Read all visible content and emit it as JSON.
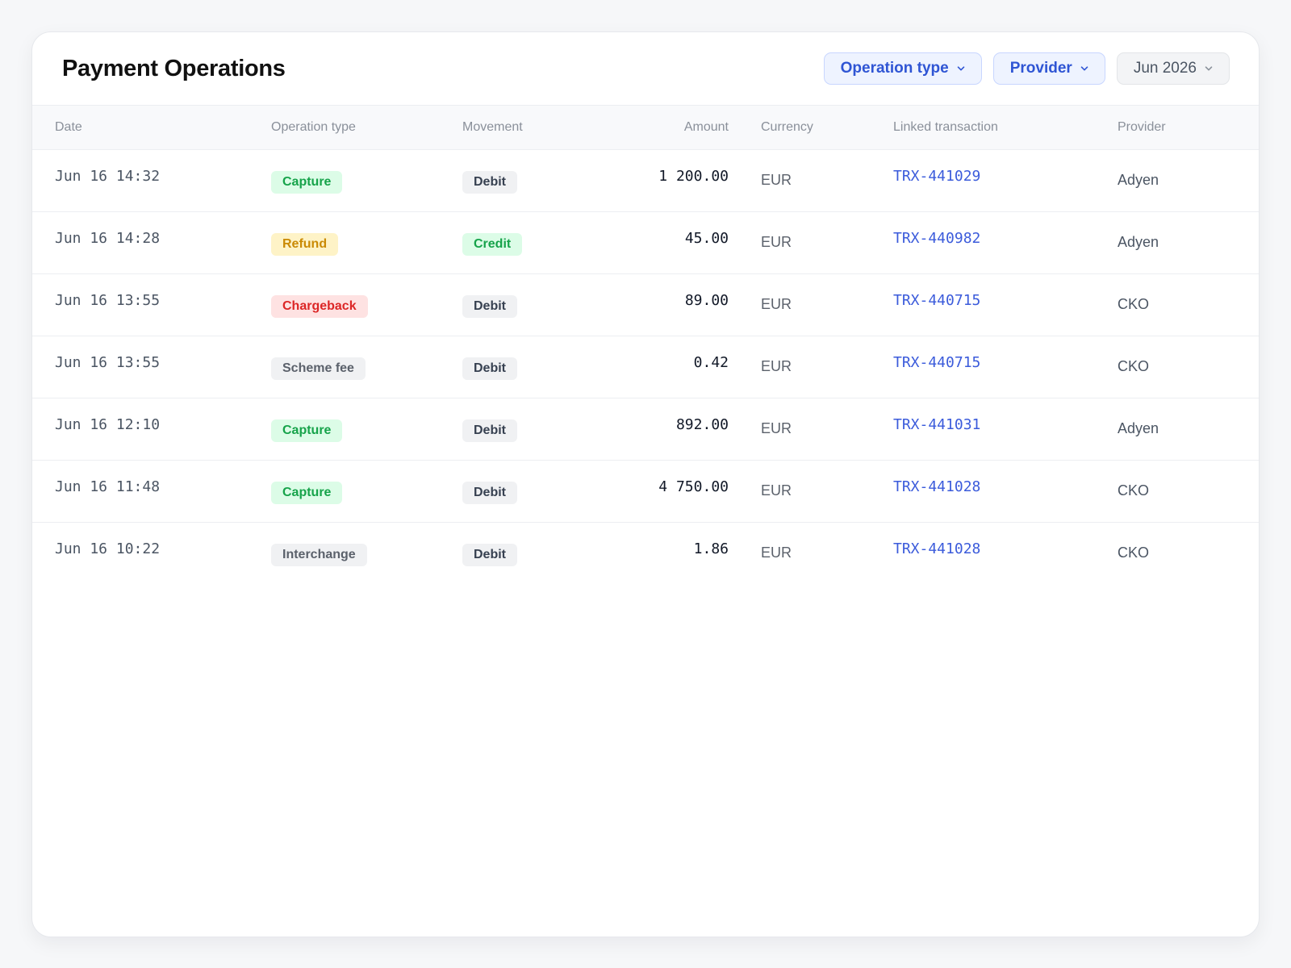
{
  "header": {
    "title": "Payment Operations",
    "filters": [
      {
        "label": "Operation type",
        "state": "active"
      },
      {
        "label": "Provider",
        "state": "active"
      },
      {
        "label": "Jun 2026",
        "state": "plain"
      }
    ]
  },
  "table": {
    "columns": [
      "Date",
      "Operation type",
      "Movement",
      "Amount",
      "Currency",
      "Linked transaction",
      "Provider"
    ],
    "rows": [
      {
        "date": "Jun 16 14:32",
        "type": "Capture",
        "type_color": "green",
        "movement": "Debit",
        "movement_color": "dark",
        "amount": "1 200.00",
        "currency": "EUR",
        "linked": "TRX-441029",
        "provider": "Adyen"
      },
      {
        "date": "Jun 16 14:28",
        "type": "Refund",
        "type_color": "yellow",
        "movement": "Credit",
        "movement_color": "green",
        "amount": "45.00",
        "currency": "EUR",
        "linked": "TRX-440982",
        "provider": "Adyen"
      },
      {
        "date": "Jun 16 13:55",
        "type": "Chargeback",
        "type_color": "red",
        "movement": "Debit",
        "movement_color": "dark",
        "amount": "89.00",
        "currency": "EUR",
        "linked": "TRX-440715",
        "provider": "CKO"
      },
      {
        "date": "Jun 16 13:55",
        "type": "Scheme fee",
        "type_color": "gray",
        "movement": "Debit",
        "movement_color": "dark",
        "amount": "0.42",
        "currency": "EUR",
        "linked": "TRX-440715",
        "provider": "CKO"
      },
      {
        "date": "Jun 16 12:10",
        "type": "Capture",
        "type_color": "green",
        "movement": "Debit",
        "movement_color": "dark",
        "amount": "892.00",
        "currency": "EUR",
        "linked": "TRX-441031",
        "provider": "Adyen"
      },
      {
        "date": "Jun 16 11:48",
        "type": "Capture",
        "type_color": "green",
        "movement": "Debit",
        "movement_color": "dark",
        "amount": "4 750.00",
        "currency": "EUR",
        "linked": "TRX-441028",
        "provider": "CKO"
      },
      {
        "date": "Jun 16 10:22",
        "type": "Interchange",
        "type_color": "gray",
        "movement": "Debit",
        "movement_color": "dark",
        "amount": "1.86",
        "currency": "EUR",
        "linked": "TRX-441028",
        "provider": "CKO"
      }
    ]
  },
  "colors": {
    "accent": "#2f55d4",
    "link": "#3b5bdb",
    "success": "#16a34a",
    "warning": "#ca8a04",
    "danger": "#dc2626"
  },
  "icons": {
    "dropdown": "chevron-down-icon"
  }
}
